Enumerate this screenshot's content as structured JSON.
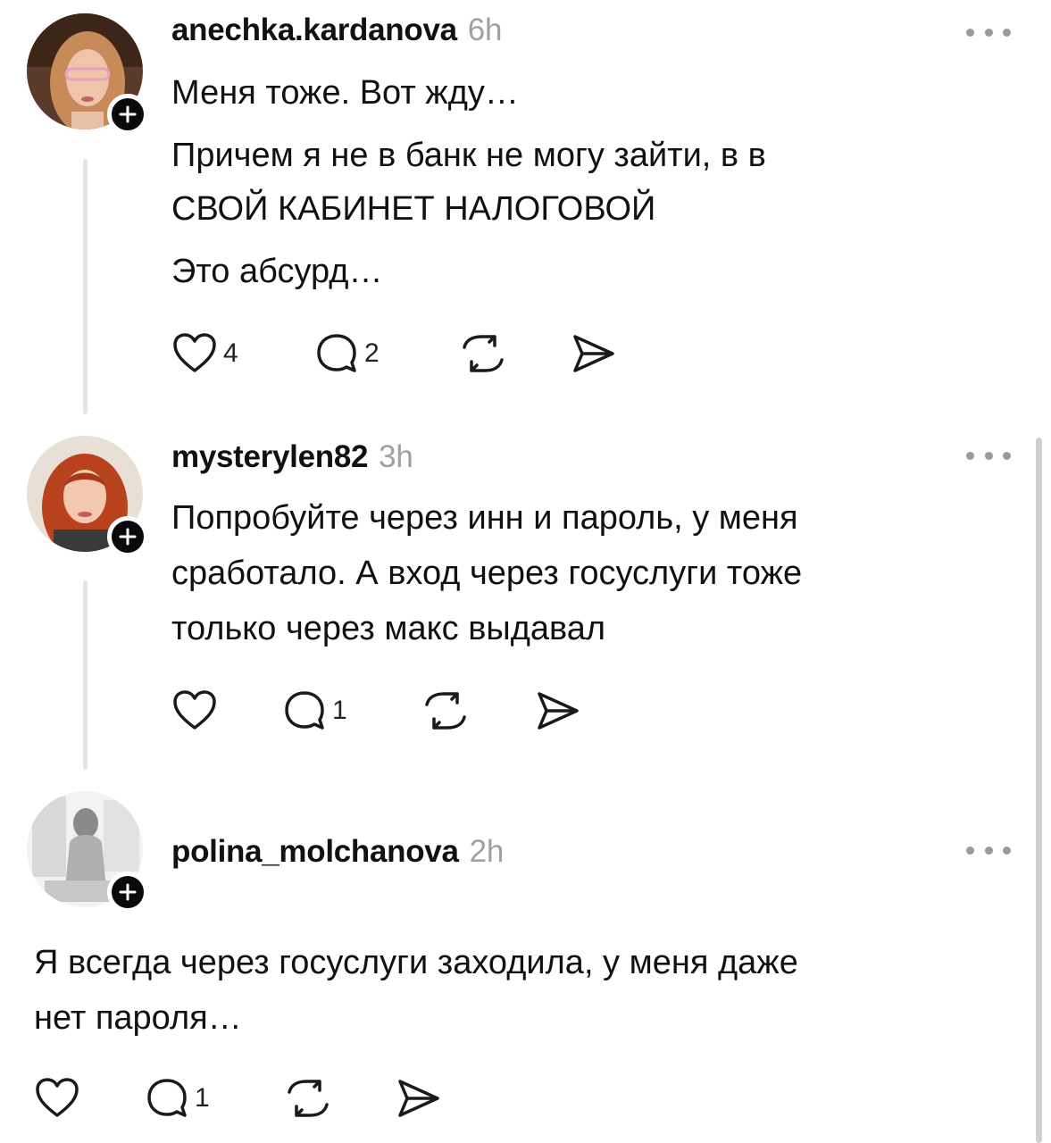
{
  "comments": [
    {
      "username": "anechka.kardanova",
      "time": "6h",
      "lines": [
        "Меня тоже. Вот жду…",
        "Причем я не в банк не могу зайти, в в",
        "СВОЙ КАБИНЕТ НАЛОГОВОЙ",
        "Это абсурд…"
      ],
      "likes": "4",
      "replies": "2"
    },
    {
      "username": "mysterylen82",
      "time": "3h",
      "lines": [
        "Попробуйте через инн и пароль, у меня",
        "сработало. А  вход через госуслуги тоже",
        "только через макс выдавал"
      ],
      "likes": "",
      "replies": "1"
    },
    {
      "username": "polina_molchanova",
      "time": "2h",
      "lines": [
        "Я всегда через госуслуги заходила, у меня даже",
        "нет пароля…"
      ],
      "likes": "",
      "replies": "1"
    }
  ],
  "icons": {
    "like": "heart-icon",
    "reply": "comment-icon",
    "repost": "repost-icon",
    "share": "send-icon",
    "more": "more-dots-icon",
    "follow": "plus-icon"
  },
  "colors": {
    "text": "#111111",
    "muted": "#a0a0a0",
    "icon": "#1a1a1a",
    "thread_line": "#e4e4e4",
    "follow_badge": "#0a0a0a"
  }
}
